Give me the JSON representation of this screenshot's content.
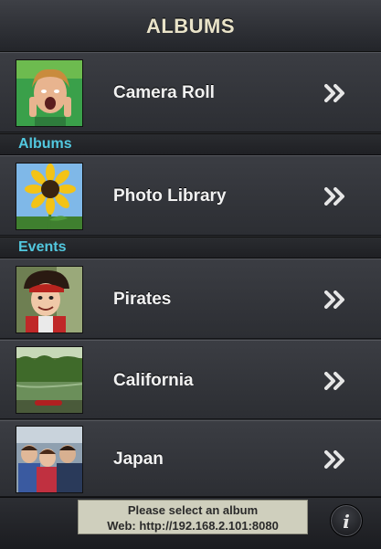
{
  "header": {
    "title": "ALBUMS"
  },
  "rows": {
    "camera_roll": {
      "label": "Camera Roll"
    },
    "photo_library": {
      "label": "Photo Library"
    },
    "pirates": {
      "label": "Pirates"
    },
    "california": {
      "label": "California"
    },
    "japan": {
      "label": "Japan"
    }
  },
  "sections": {
    "albums": "Albums",
    "events": "Events"
  },
  "status": {
    "line1": "Please select an album",
    "line2": "Web: http://192.168.2.101:8080"
  },
  "info_button": {
    "glyph": "i"
  },
  "colors": {
    "section_text": "#52c8df",
    "title_text": "#e9e3c9"
  }
}
